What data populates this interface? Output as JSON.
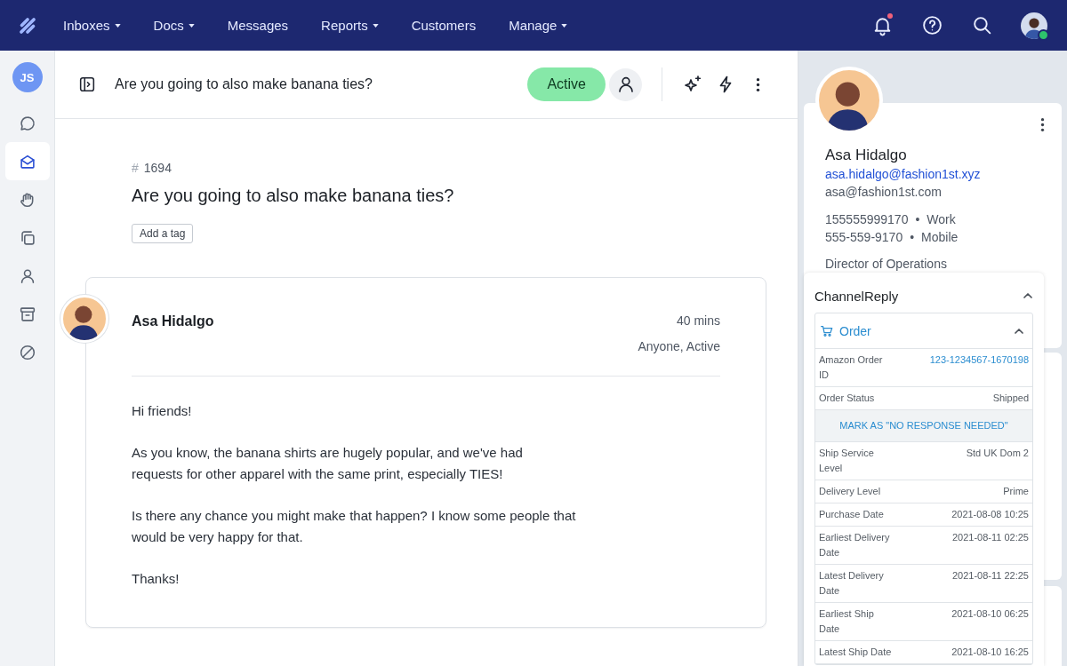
{
  "top_nav": {
    "menu": [
      {
        "label": "Inboxes",
        "dropdown": true
      },
      {
        "label": "Docs",
        "dropdown": true
      },
      {
        "label": "Messages",
        "dropdown": false
      },
      {
        "label": "Reports",
        "dropdown": true
      },
      {
        "label": "Customers",
        "dropdown": false
      },
      {
        "label": "Manage",
        "dropdown": true
      }
    ],
    "notifications_unread": true,
    "user_online": true
  },
  "sidebar": {
    "user_initials": "JS",
    "items": [
      {
        "kind": "chat",
        "selected": false
      },
      {
        "kind": "inbox",
        "selected": true
      },
      {
        "kind": "hand",
        "selected": false
      },
      {
        "kind": "docs",
        "selected": false
      },
      {
        "kind": "person",
        "selected": false
      },
      {
        "kind": "archive",
        "selected": false
      },
      {
        "kind": "blocked",
        "selected": false
      }
    ]
  },
  "header": {
    "title": "Are you going to also make banana ties?",
    "status": "Active"
  },
  "conversation": {
    "hash": "#",
    "number": "1694",
    "subject": "Are you going to also make banana ties?",
    "tag_button": "Add a tag"
  },
  "message": {
    "author": "Asa Hidalgo",
    "time": "40 mins",
    "assignment": "Anyone, Active",
    "paragraphs": [
      "Hi friends!",
      "As you know, the banana shirts are hugely popular, and we've had\nrequests for other apparel with the same print, especially TIES!",
      "Is there any chance you might make that happen? I know some people that\nwould be very happy for that.",
      "Thanks!"
    ]
  },
  "contact": {
    "name": "Asa Hidalgo",
    "emails": [
      {
        "address": "asa.hidalgo@fashion1st.xyz",
        "primary": true
      },
      {
        "address": "asa@fashion1st.com",
        "primary": false
      }
    ],
    "phones": [
      {
        "number": "155555999170",
        "separator": "•",
        "type": "Work"
      },
      {
        "number": "555-559-9170",
        "separator": "•",
        "type": "Mobile"
      }
    ],
    "job_title": "Director of Operations"
  },
  "channel_reply": {
    "title": "ChannelReply",
    "expanded": true,
    "order": {
      "title": "Order",
      "expanded": true,
      "rows": [
        {
          "kind": "field",
          "label": "Amazon Order ID",
          "value": "123-1234567-1670198",
          "link": true
        },
        {
          "kind": "field",
          "label": "Order Status",
          "value": "Shipped",
          "link": false
        },
        {
          "kind": "action",
          "label": "MARK AS \"NO RESPONSE NEEDED\""
        },
        {
          "kind": "field",
          "label": "Ship Service Level",
          "value": "Std UK Dom 2",
          "link": false
        },
        {
          "kind": "field",
          "label": "Delivery Level",
          "value": "Prime",
          "link": false
        },
        {
          "kind": "field",
          "label": "Purchase Date",
          "value": "2021-08-08 10:25",
          "link": false
        },
        {
          "kind": "field",
          "label": "Earliest Delivery Date",
          "value": "2021-08-11 02:25",
          "link": false
        },
        {
          "kind": "field",
          "label": "Latest Delivery Date",
          "value": "2021-08-11 22:25",
          "link": false
        },
        {
          "kind": "field",
          "label": "Earliest Ship Date",
          "value": "2021-08-10 06:25",
          "link": false
        },
        {
          "kind": "field",
          "label": "Latest Ship Date",
          "value": "2021-08-10 16:25",
          "link": false
        }
      ]
    }
  }
}
